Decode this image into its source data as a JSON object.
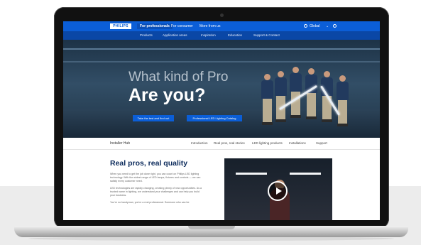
{
  "topbar": {
    "logo": "PHILIPS",
    "tabs": [
      "For professionals",
      "For consumer",
      "More from us"
    ],
    "region": "Global",
    "region_icon": "globe-icon",
    "search_icon": "search-icon"
  },
  "nav": {
    "items": [
      "Products",
      "Application areas",
      "Inspiration",
      "Education",
      "Support & Contact"
    ]
  },
  "hero": {
    "line1": "What kind of Pro",
    "line2": "Are you?",
    "button1": "Take the test and find out",
    "button2": "Professional LED Lighting Catalog"
  },
  "subnav": {
    "title": "Installer Hub",
    "items": [
      "Introduction",
      "Real pros, real stories",
      "LED lighting products",
      "Installations",
      "Support"
    ]
  },
  "content": {
    "heading": "Real pros, real quality",
    "paragraphs": [
      "When you need to get the job done right, you can count on Philips LED lighting technology. With the widest range of LED lamps, fixtures and controls — we can satisfy every customer need.",
      "LED technologies are rapidly changing, creating plenty of new opportunities. As a trusted name in lighting, we understand your challenges and can help you build your business.",
      "You're no handyman, you're a real professional. Someone who can be"
    ],
    "video_icon": "play-icon"
  },
  "colors": {
    "brand_blue": "#0b5ed7",
    "nav_dark_blue": "#0a47a6",
    "heading_navy": "#0b2a5b"
  }
}
